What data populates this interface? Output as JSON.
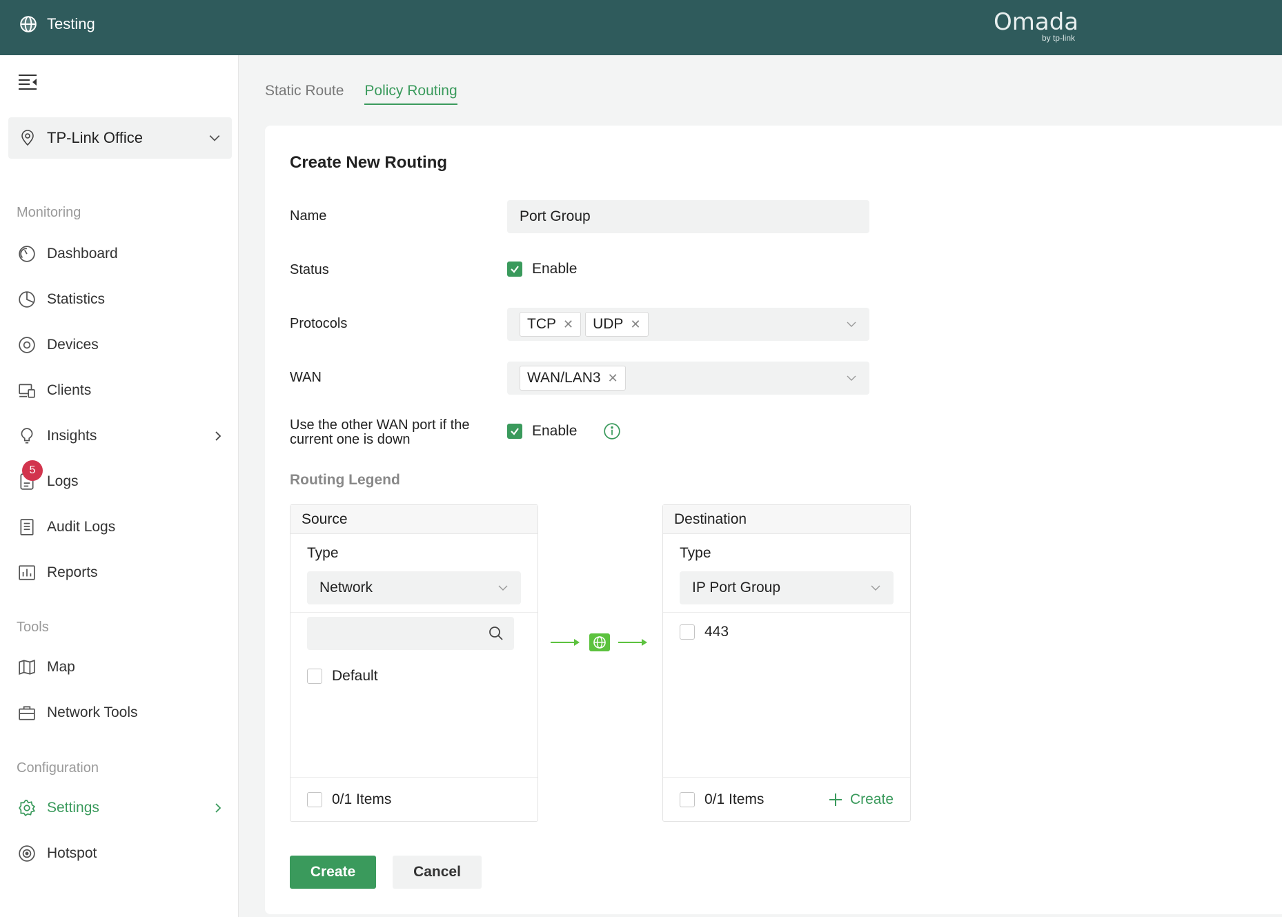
{
  "header": {
    "site_name": "Testing",
    "brand": "Omada",
    "brand_sub": "by tp-link"
  },
  "sidebar": {
    "site_selector": "TP-Link Office",
    "sections": {
      "monitoring": "Monitoring",
      "tools": "Tools",
      "configuration": "Configuration"
    },
    "items": {
      "dashboard": "Dashboard",
      "statistics": "Statistics",
      "devices": "Devices",
      "clients": "Clients",
      "insights": "Insights",
      "logs": "Logs",
      "logs_badge": "5",
      "audit_logs": "Audit Logs",
      "reports": "Reports",
      "map": "Map",
      "network_tools": "Network Tools",
      "settings": "Settings",
      "hotspot": "Hotspot"
    }
  },
  "tabs": {
    "static_route": "Static Route",
    "policy_routing": "Policy Routing"
  },
  "form": {
    "title": "Create New Routing",
    "name_label": "Name",
    "name_value": "Port Group",
    "status_label": "Status",
    "status_enable": "Enable",
    "protocols_label": "Protocols",
    "protocols": [
      "TCP",
      "UDP"
    ],
    "wan_label": "WAN",
    "wan": [
      "WAN/LAN3"
    ],
    "failover_label_1": "Use the other WAN port if the",
    "failover_label_2": "current one is down",
    "failover_enable": "Enable",
    "legend_title": "Routing Legend",
    "source": {
      "title": "Source",
      "type_label": "Type",
      "type_value": "Network",
      "search_placeholder": "",
      "items": [
        "Default"
      ],
      "count": "0/1 Items"
    },
    "destination": {
      "title": "Destination",
      "type_label": "Type",
      "type_value": "IP Port Group",
      "items": [
        "443"
      ],
      "count": "0/1 Items",
      "create_link": "Create"
    },
    "create_button": "Create",
    "cancel_button": "Cancel"
  },
  "colors": {
    "header_bg": "#2f5b5c",
    "accent": "#3a9a5c",
    "badge": "#d2344d",
    "flow_green": "#5cc23e"
  }
}
